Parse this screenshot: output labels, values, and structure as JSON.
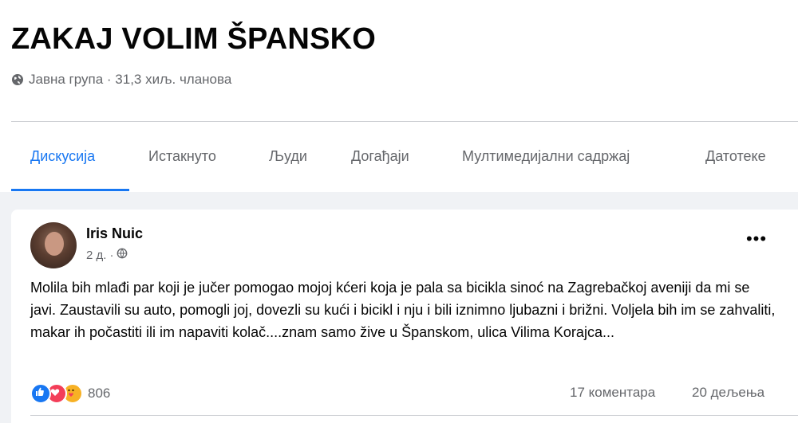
{
  "group": {
    "title": "ZAKAJ VOLIM ŠPANSKO",
    "meta": "Јавна група · 31,3 хиљ. чланова",
    "globe_icon": "globe-icon"
  },
  "tabs": [
    {
      "label": "Дискусија",
      "active": true
    },
    {
      "label": "Истакнуто",
      "active": false
    },
    {
      "label": "Људи",
      "active": false
    },
    {
      "label": "Догађаји",
      "active": false
    },
    {
      "label": "Мултимедијални садржај",
      "active": false
    },
    {
      "label": "Датотеке",
      "active": false
    }
  ],
  "accent_color": "#1877f2",
  "post": {
    "author": "Iris Nuic",
    "time": "2 д.",
    "separator": "·",
    "privacy_icon": "globe-icon",
    "more_label": "•••",
    "text": "Molila bih mlađi par  koji je jučer pomogao mojoj kćeri koja je pala sa bicikla sinoć na Zagrebačkoj aveniji da mi se javi. Zaustavili su auto, pomogli joj, dovezli su kući i bicikl i nju i bili iznimno ljubazni i brižni.  Voljela bih im se zahvaliti, makar ih počastiti ili im napaviti kolač....znam samo žive u Španskom, ulica Vilima Korajca...",
    "reactions": {
      "icons": [
        "like-icon",
        "love-icon",
        "care-icon"
      ],
      "count": "806"
    },
    "comments": "17 коментара",
    "shares": "20 дељења"
  }
}
